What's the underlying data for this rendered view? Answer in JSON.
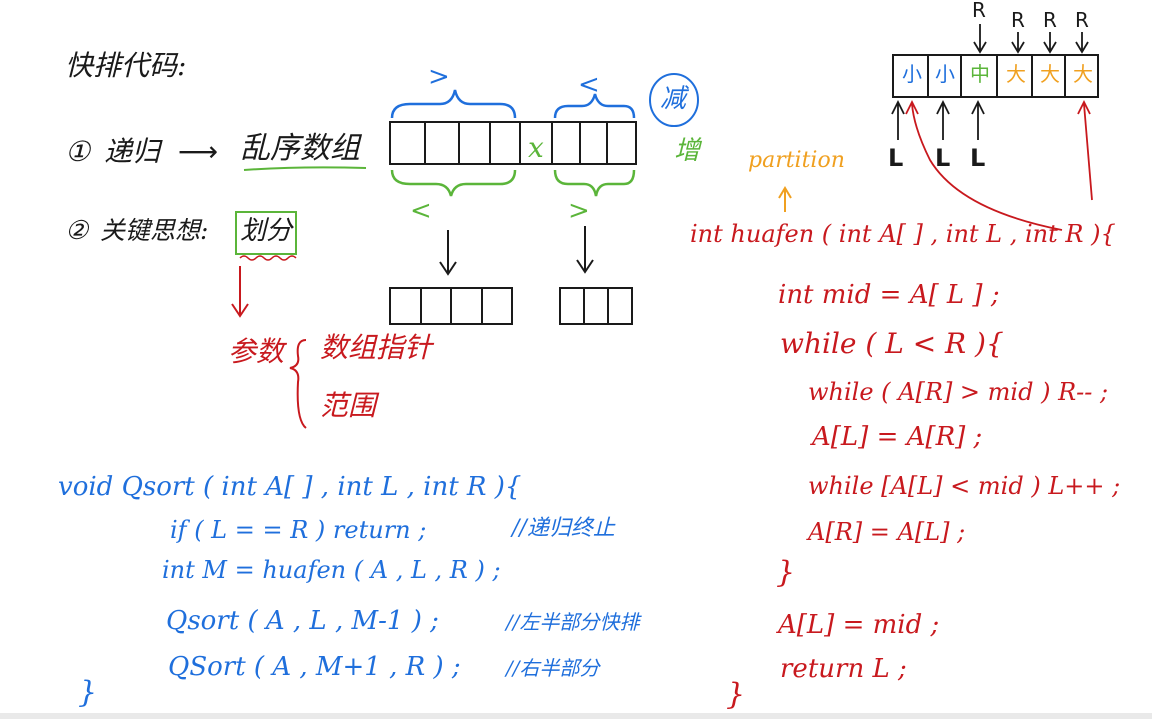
{
  "title": "快排代码:",
  "point1": {
    "num": "①",
    "label": "递归",
    "arrow": "⟶",
    "target": "乱序数组"
  },
  "point2": {
    "num": "②",
    "label": "关键思想:",
    "key": "划分"
  },
  "params": {
    "label": "参数",
    "item1": "数组指针",
    "item2": "范围"
  },
  "array_diagram": {
    "top_left": ">",
    "top_right": "<",
    "pivot": "x",
    "bottom_left": "<",
    "bottom_right": ">",
    "circle_label": "减",
    "side_label": "增"
  },
  "partition_label": "partition",
  "partition_example": {
    "cells": [
      "小",
      "小",
      "中",
      "大",
      "大",
      "大"
    ],
    "top_markers": [
      "R",
      "R",
      "R",
      "R"
    ],
    "bottom_markers": [
      "L",
      "L",
      "L"
    ]
  },
  "qsort_code": [
    "void  Qsort ( int A[ ] , int L , int R ){",
    "if ( L = = R )   return ;",
    "//递归终止",
    "int M = huafen ( A , L , R ) ;",
    "Qsort ( A , L , M-1 ) ;",
    "//左半部分快排",
    "QSort ( A , M+1 , R ) ;",
    "//右半部分",
    "}"
  ],
  "huafen_code": [
    "int  huafen ( int A[ ] , int L , int R ){",
    "int mid = A[ L ] ;",
    "while ( L < R ){",
    "while ( A[R] > mid )  R-- ;",
    "A[L] = A[R] ;",
    "while [A[L] < mid )  L++ ;",
    "A[R] = A[L] ;",
    "}",
    "A[L] = mid ;",
    "return L ;",
    "}"
  ],
  "colors": {
    "black": "#1a1a1a",
    "blue": "#1f6fdc",
    "red": "#c8191e",
    "green": "#5bb53a",
    "orange": "#f0a020"
  }
}
